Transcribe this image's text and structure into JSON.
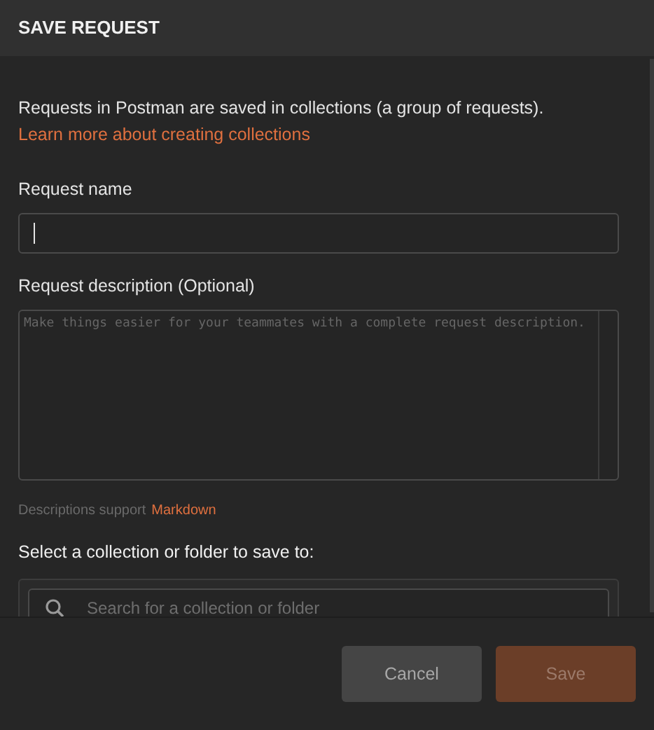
{
  "dialog": {
    "title": "SAVE REQUEST"
  },
  "intro": {
    "text": "Requests in Postman are saved in collections (a group of requests).",
    "link": "Learn more about creating collections"
  },
  "request_name": {
    "label": "Request name"
  },
  "request_description": {
    "label": "Request description (Optional)",
    "placeholder": "Make things easier for your teammates with a complete request description."
  },
  "description_hint": {
    "text": "Descriptions support",
    "link": "Markdown"
  },
  "collection_picker": {
    "label": "Select a collection or folder to save to:",
    "search": {
      "placeholder": "Search for a collection or folder"
    }
  },
  "buttons": [
    {
      "label": "Cancel",
      "kind": "secondary",
      "disabled": false
    },
    {
      "label": "Save",
      "kind": "primary",
      "disabled": true
    }
  ]
}
